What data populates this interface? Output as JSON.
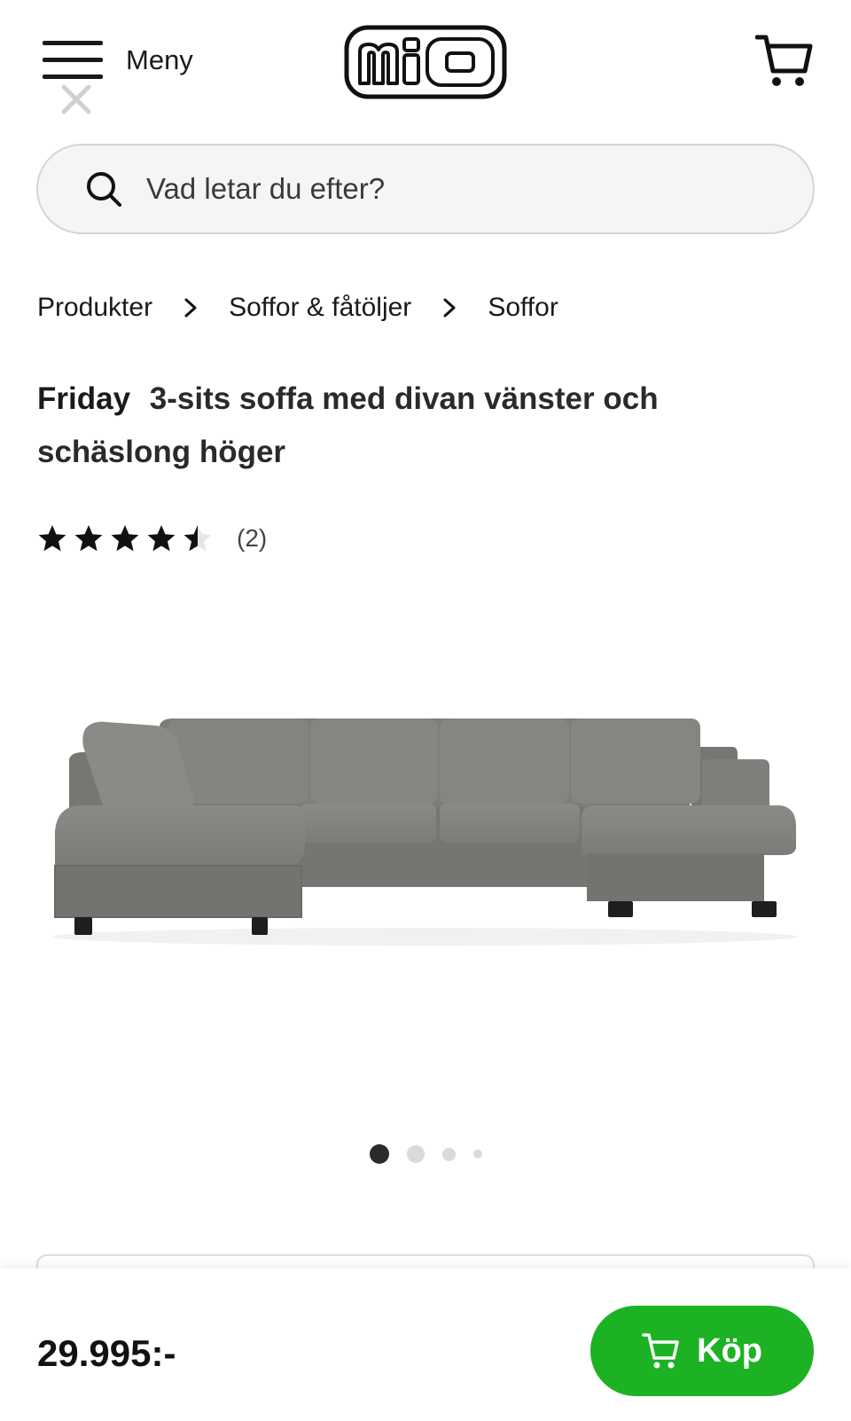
{
  "header": {
    "menu_label": "Meny",
    "logo_text": "MIO",
    "cart_icon": "cart-icon",
    "menu_icon": "hamburger-icon"
  },
  "search": {
    "placeholder": "Vad letar du efter?",
    "icon": "search-icon"
  },
  "breadcrumb": {
    "items": [
      "Produkter",
      "Soffor & fåtöljer",
      "Soffor"
    ]
  },
  "product": {
    "brand": "Friday",
    "description": "3-sits soffa med divan vänster och schäslong höger",
    "rating": 4.5,
    "rating_max": 5,
    "review_count_label": "(2)",
    "image_count": 4,
    "active_image": 1
  },
  "buy_bar": {
    "price": "29.995:-",
    "buy_label": "Köp",
    "button_color": "#1db224"
  },
  "colors": {
    "accent_green": "#1db224",
    "text": "#1a1a1a",
    "search_bg": "#f5f5f5"
  }
}
